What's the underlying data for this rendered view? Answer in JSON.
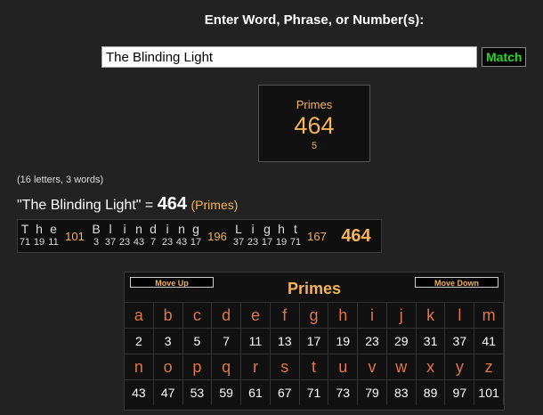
{
  "header": {
    "title": "Enter Word, Phrase, or Number(s):"
  },
  "search": {
    "value": "The Blinding Light",
    "match_label": "Match"
  },
  "result_box": {
    "cipher": "Primes",
    "value": "464",
    "rank": "5"
  },
  "counts": "(16 letters, 3 words)",
  "equation": {
    "phrase": "\"The Blinding Light\"",
    "equals": " = ",
    "value": "464",
    "cipher": "(Primes)"
  },
  "breakdown": {
    "words": [
      {
        "letters": [
          {
            "ch": "T",
            "val": "71"
          },
          {
            "ch": "h",
            "val": "19"
          },
          {
            "ch": "e",
            "val": "11"
          }
        ],
        "sum": "101"
      },
      {
        "letters": [
          {
            "ch": "B",
            "val": "3"
          },
          {
            "ch": "l",
            "val": "37"
          },
          {
            "ch": "i",
            "val": "23"
          },
          {
            "ch": "n",
            "val": "43"
          },
          {
            "ch": "d",
            "val": "7"
          },
          {
            "ch": "i",
            "val": "23"
          },
          {
            "ch": "n",
            "val": "43"
          },
          {
            "ch": "g",
            "val": "17"
          }
        ],
        "sum": "196"
      },
      {
        "letters": [
          {
            "ch": "L",
            "val": "37"
          },
          {
            "ch": "i",
            "val": "23"
          },
          {
            "ch": "g",
            "val": "17"
          },
          {
            "ch": "h",
            "val": "19"
          },
          {
            "ch": "t",
            "val": "71"
          }
        ],
        "sum": "167"
      }
    ],
    "total": "464"
  },
  "cipher_table": {
    "title": "Primes",
    "move_up": "Move Up",
    "move_down": "Move Down",
    "rows": [
      {
        "letters": [
          "a",
          "b",
          "c",
          "d",
          "e",
          "f",
          "g",
          "h",
          "i",
          "j",
          "k",
          "l",
          "m"
        ],
        "values": [
          "2",
          "3",
          "5",
          "7",
          "11",
          "13",
          "17",
          "19",
          "23",
          "29",
          "31",
          "37",
          "41"
        ]
      },
      {
        "letters": [
          "n",
          "o",
          "p",
          "q",
          "r",
          "s",
          "t",
          "u",
          "v",
          "w",
          "x",
          "y",
          "z"
        ],
        "values": [
          "43",
          "47",
          "53",
          "59",
          "61",
          "67",
          "71",
          "73",
          "79",
          "83",
          "89",
          "97",
          "101"
        ]
      }
    ]
  },
  "colors": {
    "accent": "#f5b35a",
    "letter": "#e0764a",
    "match": "#22dd22",
    "background": "#222222"
  }
}
